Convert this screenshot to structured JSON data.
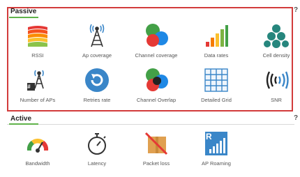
{
  "passive": {
    "title": "Passive",
    "help": "?",
    "tools": [
      {
        "label": "RSSI",
        "icon": "rssi-heatmap-icon"
      },
      {
        "label": "Ap coverage",
        "icon": "antenna-tower-icon"
      },
      {
        "label": "Channel coverage",
        "icon": "channel-circles-icon"
      },
      {
        "label": "Data rates",
        "icon": "signal-bars-icon"
      },
      {
        "label": "Cell density",
        "icon": "cell-density-icon"
      },
      {
        "label": "Number of APs",
        "icon": "ap-count-icon"
      },
      {
        "label": "Retries rate",
        "icon": "retry-arrow-icon"
      },
      {
        "label": "Channel Overlap",
        "icon": "channel-overlap-icon"
      },
      {
        "label": "Detailed Grid",
        "icon": "grid-icon"
      },
      {
        "label": "SNR",
        "icon": "snr-waves-icon"
      }
    ],
    "ap_count_badge": "#"
  },
  "active": {
    "title": "Active",
    "help": "?",
    "tools": [
      {
        "label": "Bandwidth",
        "icon": "speedometer-icon"
      },
      {
        "label": "Latency",
        "icon": "stopwatch-icon"
      },
      {
        "label": "Packet loss",
        "icon": "packet-box-icon"
      },
      {
        "label": "AP Roaming",
        "icon": "roaming-icon"
      }
    ],
    "roaming_badge": "R"
  },
  "colors": {
    "selection_border": "#d23b3b",
    "accent_green": "#5fb34a",
    "icon_blue": "#3a86c8",
    "label_gray": "#555555"
  }
}
